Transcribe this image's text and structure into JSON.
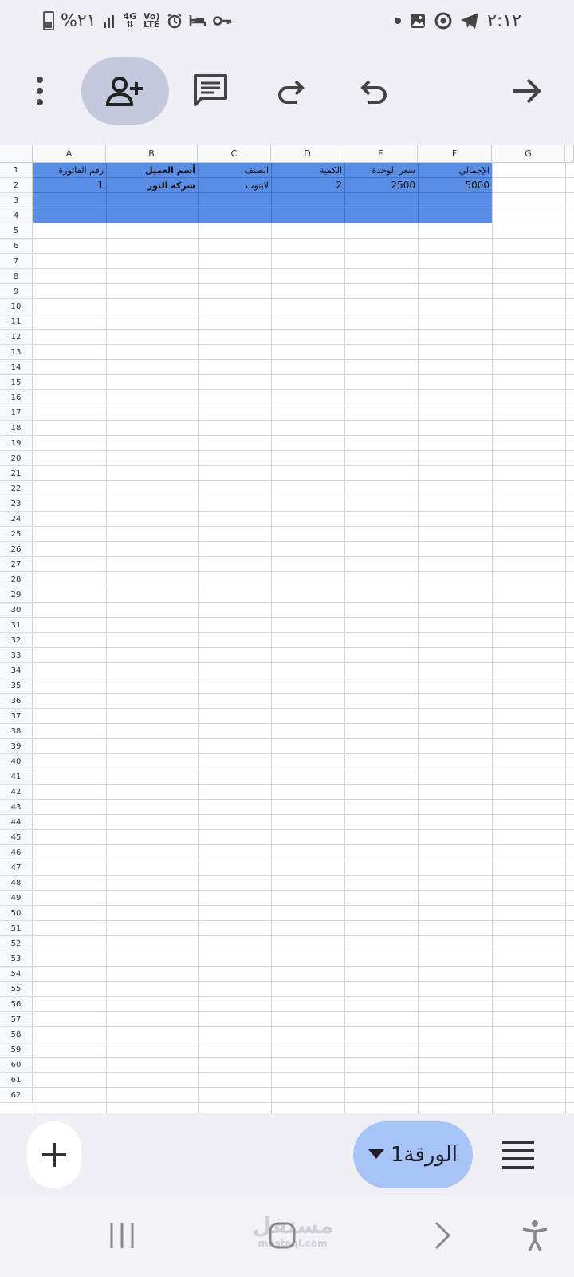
{
  "status_bar": {
    "time": "٢:١٢",
    "battery_percent": "%٢١",
    "network": "4G",
    "volte": "Vo) LTE",
    "icons_left": [
      "battery-icon",
      "signal-icon",
      "network-4g-icon",
      "volte-icon",
      "alarm-icon",
      "bed-icon",
      "vpn-key-icon"
    ],
    "icons_right": [
      "dot-icon",
      "gallery-icon",
      "chrome-icon",
      "telegram-icon"
    ]
  },
  "toolbar": {
    "buttons": [
      "more-options",
      "share-add-person",
      "comment",
      "redo",
      "undo",
      "forward-arrow"
    ]
  },
  "sheet": {
    "columns": [
      "A",
      "B",
      "C",
      "D",
      "E",
      "F",
      "G"
    ],
    "row_numbers": [
      "1",
      "2",
      "3",
      "4",
      "5",
      "6",
      "7",
      "8",
      "9",
      "10",
      "11",
      "12",
      "13",
      "14",
      "15",
      "16",
      "17",
      "18",
      "19",
      "20",
      "21",
      "22",
      "23",
      "24",
      "25",
      "26",
      "27",
      "28",
      "29",
      "30",
      "31",
      "32",
      "33",
      "34",
      "35",
      "36",
      "37",
      "38",
      "39",
      "40",
      "41",
      "42",
      "43",
      "44",
      "45",
      "46",
      "47",
      "48",
      "49",
      "50",
      "51",
      "52",
      "53",
      "54",
      "55",
      "56",
      "57",
      "58",
      "59",
      "60",
      "61",
      "62"
    ],
    "header_row": {
      "a": "رقم الفاتورة",
      "b": "أسم العميل",
      "c": "الصنف",
      "d": "الكمية",
      "e": "سعر الوحدة",
      "f": "الإجمالي"
    },
    "data_row": {
      "a": "1",
      "b": "شركة النور",
      "c": "لابتوب",
      "d": "2",
      "e": "2500",
      "f": "5000"
    },
    "selection": "A1:F4",
    "selection_color": "#5a8de6"
  },
  "bottom_bar": {
    "sheet_tab_label": "الورقة1"
  },
  "nav_bar": {
    "watermark": "مستقل",
    "watermark_sub": "mostaql.com"
  },
  "colors": {
    "background": "#f0eff5",
    "active_button": "#c4c9dd",
    "sheet_pill": "#a7c4f7"
  }
}
